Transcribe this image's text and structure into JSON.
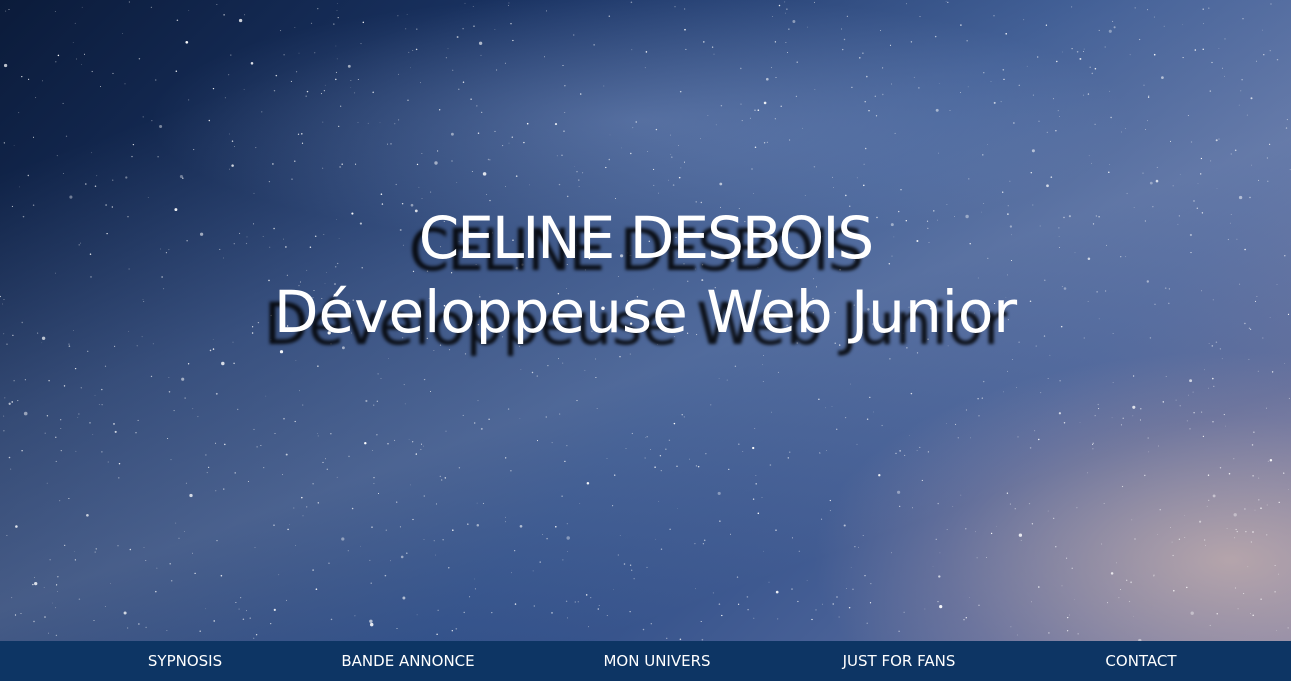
{
  "hero": {
    "name": "CELINE DESBOIS",
    "role": "Développeuse Web Junior",
    "background": "starry-night-sky"
  },
  "nav": {
    "background_color": "#0d3564",
    "text_color": "#ffffff",
    "items": [
      {
        "label": "SYPNOSIS"
      },
      {
        "label": "BANDE ANNONCE"
      },
      {
        "label": "MON UNIVERS"
      },
      {
        "label": "JUST FOR FANS"
      },
      {
        "label": "CONTACT"
      }
    ]
  }
}
